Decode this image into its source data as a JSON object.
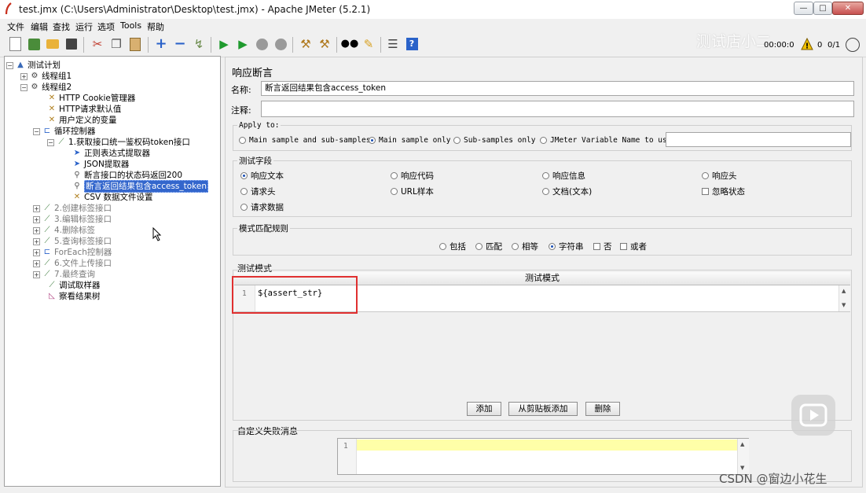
{
  "window": {
    "title": "test.jmx (C:\\Users\\Administrator\\Desktop\\test.jmx) - Apache JMeter (5.2.1)",
    "minimize": "—",
    "maximize": "□",
    "close": "✕"
  },
  "menu": [
    "文件",
    "编辑",
    "查找",
    "运行",
    "选项",
    "Tools",
    "帮助"
  ],
  "toolbar": {
    "timer": "00:00:0",
    "warnings": "0",
    "threads": "0/1",
    "watermark": "测试店小二"
  },
  "tree": [
    {
      "label": "测试计划",
      "icon": "test-plan-icon"
    },
    {
      "label": "线程组1",
      "icon": "thread-group-icon"
    },
    {
      "label": "线程组2",
      "icon": "thread-group-icon"
    },
    {
      "label": "HTTP Cookie管理器",
      "icon": "config-icon"
    },
    {
      "label": "HTTP请求默认值",
      "icon": "config-icon"
    },
    {
      "label": "用户定义的变量",
      "icon": "config-icon"
    },
    {
      "label": "循环控制器",
      "icon": "controller-icon"
    },
    {
      "label": "1.获取接口统一鉴权码token接口",
      "icon": "sampler-icon"
    },
    {
      "label": "正则表达式提取器",
      "icon": "extractor-icon"
    },
    {
      "label": "JSON提取器",
      "icon": "extractor-icon"
    },
    {
      "label": "断言接口的状态码返回200",
      "icon": "assertion-icon"
    },
    {
      "label": "断言返回结果包含access_token",
      "icon": "assertion-icon"
    },
    {
      "label": "CSV 数据文件设置",
      "icon": "config-icon"
    },
    {
      "label": "2.创建标签接口",
      "icon": "sampler-icon"
    },
    {
      "label": "3.编辑标签接口",
      "icon": "sampler-icon"
    },
    {
      "label": "4.删除标签",
      "icon": "sampler-icon"
    },
    {
      "label": "5.查询标签接口",
      "icon": "sampler-icon"
    },
    {
      "label": "ForEach控制器",
      "icon": "controller-icon"
    },
    {
      "label": "6.文件上传接口",
      "icon": "sampler-icon"
    },
    {
      "label": "7.最终查询",
      "icon": "sampler-icon"
    },
    {
      "label": "调试取样器",
      "icon": "sampler-icon"
    },
    {
      "label": "察看结果树",
      "icon": "listener-icon"
    }
  ],
  "panel": {
    "title": "响应断言",
    "name_label": "名称:",
    "name_value": "断言返回结果包含access_token",
    "comment_label": "注释:",
    "comment_value": "",
    "apply_to": {
      "legend": "Apply to:",
      "options": [
        "Main sample and sub-samples",
        "Main sample only",
        "Sub-samples only",
        "JMeter Variable Name to use"
      ],
      "selected": "Main sample only",
      "variable_value": ""
    },
    "test_field": {
      "legend": "测试字段",
      "options": [
        "响应文本",
        "响应代码",
        "响应信息",
        "响应头",
        "请求头",
        "URL样本",
        "文档(文本)",
        "请求数据"
      ],
      "selected": "响应文本",
      "ignore_status": "忽略状态",
      "ignore_status_checked": false
    },
    "match_rules": {
      "legend": "模式匹配规则",
      "options": [
        "包括",
        "匹配",
        "相等",
        "字符串"
      ],
      "selected": "字符串",
      "not_label": "否",
      "not_checked": false,
      "or_label": "或者",
      "or_checked": false
    },
    "patterns": {
      "legend": "测试模式",
      "column_header": "测试模式",
      "rows": [
        {
          "line": "1",
          "text": "${assert_str}"
        }
      ]
    },
    "buttons": {
      "add": "添加",
      "add_clipboard": "从剪贴板添加",
      "delete": "删除"
    },
    "custom_failure": {
      "legend": "自定义失败消息",
      "line": "1",
      "text": ""
    }
  },
  "overlay": {
    "csdn": "CSDN @窗边小花生"
  },
  "colors": {
    "selection": "#3366cc",
    "highlight_box": "#e03030",
    "failure_line": "#ffffa8"
  }
}
